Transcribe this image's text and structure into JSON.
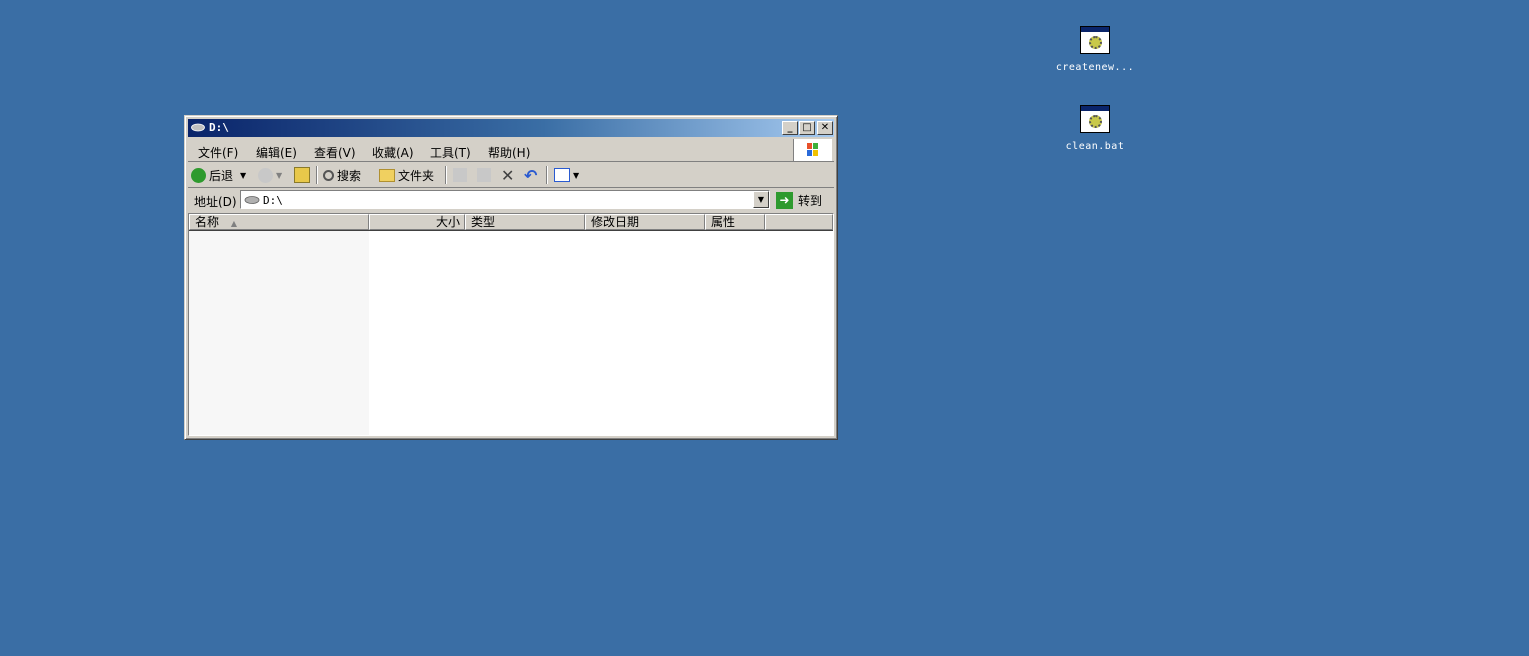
{
  "desktop": {
    "icons": [
      {
        "label": "createnew...",
        "icon": "batch-file-icon"
      },
      {
        "label": "clean.bat",
        "icon": "batch-file-icon"
      }
    ],
    "background_color": "#3a6ea5"
  },
  "window": {
    "title": "D:\\",
    "title_icon": "drive-icon",
    "controls": {
      "minimize": "_",
      "maximize": "□",
      "close": "✕"
    }
  },
  "menu": {
    "file": "文件(F)",
    "edit": "编辑(E)",
    "view": "查看(V)",
    "favorites": "收藏(A)",
    "tools": "工具(T)",
    "help": "帮助(H)"
  },
  "toolbar": {
    "back_label": "后退",
    "search_label": "搜索",
    "folders_label": "文件夹"
  },
  "address": {
    "label": "地址(D)",
    "value": "D:\\",
    "go_label": "转到"
  },
  "list": {
    "columns": [
      "名称",
      "大小",
      "类型",
      "修改日期",
      "属性"
    ],
    "rows": []
  }
}
